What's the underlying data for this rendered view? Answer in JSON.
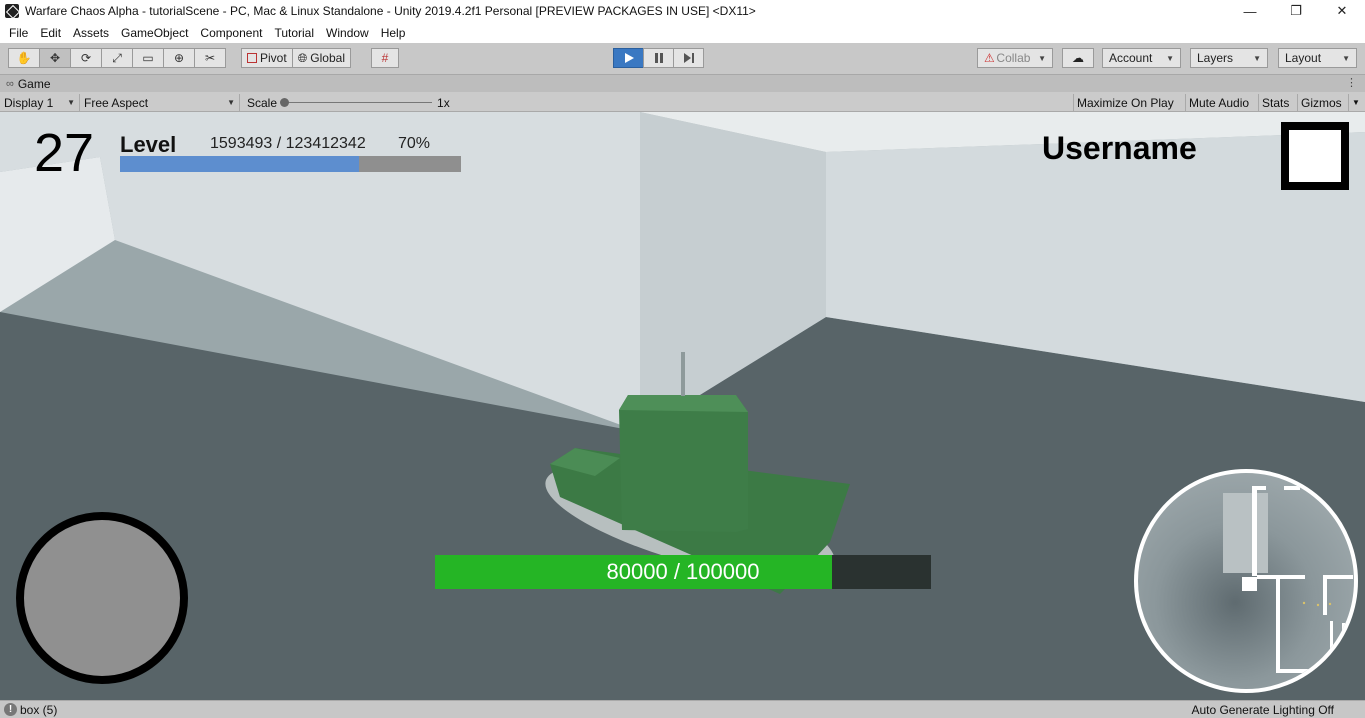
{
  "window": {
    "title": "Warfare Chaos Alpha - tutorialScene - PC, Mac & Linux Standalone - Unity 2019.4.2f1 Personal [PREVIEW PACKAGES IN USE] <DX11>",
    "minimize_glyph": "—",
    "maximize_glyph": "❐",
    "close_glyph": "✕"
  },
  "menu": [
    "File",
    "Edit",
    "Assets",
    "GameObject",
    "Component",
    "Tutorial",
    "Window",
    "Help"
  ],
  "toolbar": {
    "tools": [
      {
        "name": "hand-tool-icon",
        "glyph": "✋"
      },
      {
        "name": "move-tool-icon",
        "glyph": "✥"
      },
      {
        "name": "rotate-tool-icon",
        "glyph": "⟳"
      },
      {
        "name": "scale-tool-icon",
        "glyph": "⤢"
      },
      {
        "name": "rect-tool-icon",
        "glyph": "▭"
      },
      {
        "name": "transform-tool-icon",
        "glyph": "⊕"
      },
      {
        "name": "custom-tool-icon",
        "glyph": "✂"
      }
    ],
    "pivot_label": "Pivot",
    "global_label": "Global",
    "grid_glyph": "#",
    "collab_label": "Collab",
    "account_label": "Account",
    "layers_label": "Layers",
    "layout_label": "Layout"
  },
  "game_tab": {
    "label": "Game",
    "display": "Display 1",
    "aspect": "Free Aspect",
    "scale_label": "Scale",
    "scale_value": "1x",
    "maximize_on_play": "Maximize On Play",
    "mute_audio": "Mute Audio",
    "stats": "Stats",
    "gizmos": "Gizmos"
  },
  "hud": {
    "level_number": "27",
    "level_label": "Level",
    "xp_text": "1593493 / 123412342",
    "xp_percent": "70%",
    "xp_fraction": 0.7,
    "username": "Username",
    "health_text": "80000 / 100000",
    "health_fraction": 0.8
  },
  "colors": {
    "xp_fill": "#5d8ecf",
    "health_fill": "#25b525",
    "tank": "#3c7a45",
    "play_active": "#3a78c2"
  },
  "status": {
    "message": "box (5)",
    "right_text": "Auto Generate Lighting Off"
  }
}
